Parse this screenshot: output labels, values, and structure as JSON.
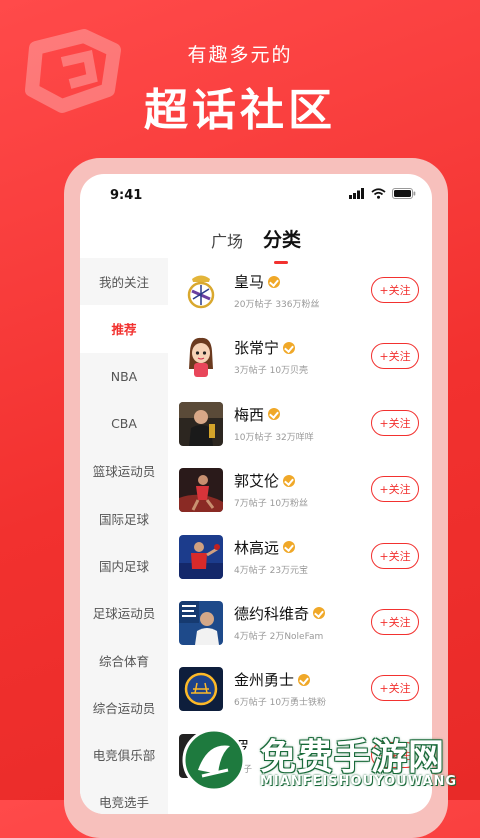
{
  "hero": {
    "subtitle": "有趣多元的",
    "title": "超话社区"
  },
  "status_bar": {
    "time": "9:41",
    "icons": [
      "signal-icon",
      "wifi-icon",
      "battery-icon"
    ]
  },
  "tabs": [
    {
      "label": "广场",
      "active": false
    },
    {
      "label": "分类",
      "active": true
    }
  ],
  "sidebar": {
    "items": [
      {
        "label": "我的关注",
        "active": false
      },
      {
        "label": "推荐",
        "active": true
      },
      {
        "label": "NBA",
        "active": false
      },
      {
        "label": "CBA",
        "active": false
      },
      {
        "label": "篮球运动员",
        "active": false
      },
      {
        "label": "国际足球",
        "active": false
      },
      {
        "label": "国内足球",
        "active": false
      },
      {
        "label": "足球运动员",
        "active": false
      },
      {
        "label": "综合体育",
        "active": false
      },
      {
        "label": "综合运动员",
        "active": false
      },
      {
        "label": "电竞俱乐部",
        "active": false
      },
      {
        "label": "电竞选手",
        "active": false
      }
    ]
  },
  "communities": [
    {
      "name": "皇马",
      "meta": "20万帖子 336万粉丝",
      "follow_label": "+关注",
      "avatar": "real-madrid-crest"
    },
    {
      "name": "张常宁",
      "meta": "3万帖子 10万贝壳",
      "follow_label": "+关注",
      "avatar": "cartoon-girl"
    },
    {
      "name": "梅西",
      "meta": "10万帖子 32万咩咩",
      "follow_label": "+关注",
      "avatar": "photo-messi"
    },
    {
      "name": "郭艾伦",
      "meta": "7万帖子 10万粉丝",
      "follow_label": "+关注",
      "avatar": "photo-basketball"
    },
    {
      "name": "林高远",
      "meta": "4万帖子 23万元宝",
      "follow_label": "+关注",
      "avatar": "photo-table-tennis"
    },
    {
      "name": "德约科维奇",
      "meta": "4万帖子 2万NoleFam",
      "follow_label": "+关注",
      "avatar": "photo-djokovic"
    },
    {
      "name": "金州勇士",
      "meta": "6万帖子 10万勇士铁粉",
      "follow_label": "+关注",
      "avatar": "warriors-logo"
    },
    {
      "name": "罗",
      "meta": "帖子",
      "follow_label": "+关注",
      "avatar": "photo-dark"
    }
  ],
  "watermark": {
    "title": "免费手游网",
    "subtitle": "MIANFEISHOUYOUWANG"
  },
  "colors": {
    "accent": "#f2312f",
    "badge": "#f0a828",
    "background": "#ff4a4a"
  }
}
